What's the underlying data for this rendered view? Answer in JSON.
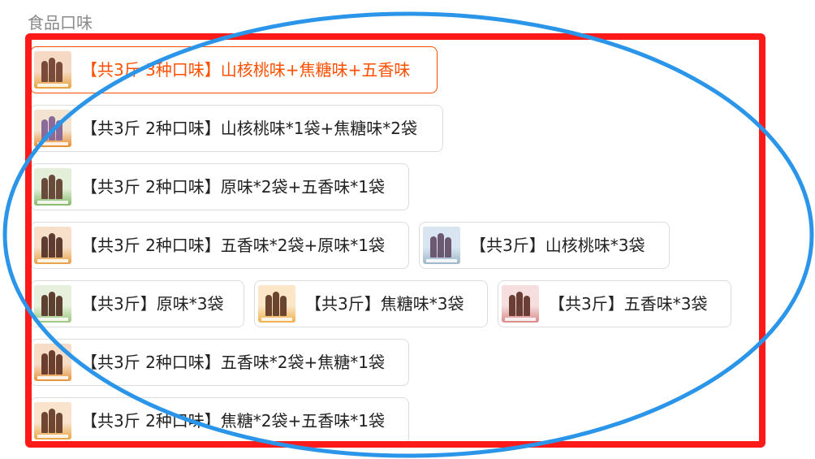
{
  "section_title": "食品口味",
  "options": [
    {
      "label": "【共3斤 3种口味】山核桃味+焦糖味+五香味",
      "selected": true,
      "thumb": {
        "bg": "#f6d9c4",
        "box": "#e6a33a",
        "beans": "#7a4a3a"
      }
    },
    {
      "label": "【共3斤 2种口味】山核桃味*1袋+焦糖味*2袋",
      "selected": false,
      "thumb": {
        "bg": "#f3e4d2",
        "box": "#e98c2d",
        "beans": "#8a6a9a"
      }
    },
    {
      "label": "【共3斤 2种口味】原味*2袋+五香味*1袋",
      "selected": false,
      "thumb": {
        "bg": "#e3efd9",
        "box": "#86b86a",
        "beans": "#6a4a3a"
      }
    },
    {
      "label": "【共3斤 2种口味】五香味*2袋+原味*1袋",
      "selected": false,
      "thumb": {
        "bg": "#f7dfc9",
        "box": "#e7a145",
        "beans": "#5f3c30"
      }
    },
    {
      "label": "【共3斤】山核桃味*3袋",
      "selected": false,
      "thumb": {
        "bg": "#d9e6f2",
        "box": "#9fb6c8",
        "beans": "#6c5870"
      }
    },
    {
      "label": "【共3斤】原味*3袋",
      "selected": false,
      "thumb": {
        "bg": "#e6f0dc",
        "box": "#9cc77d",
        "beans": "#5e4032"
      }
    },
    {
      "label": "【共3斤】焦糖味*3袋",
      "selected": false,
      "thumb": {
        "bg": "#fbe6c8",
        "box": "#f0b04c",
        "beans": "#6b4430"
      }
    },
    {
      "label": "【共3斤】五香味*3袋",
      "selected": false,
      "thumb": {
        "bg": "#f6dede",
        "box": "#d98a8a",
        "beans": "#6a3e34"
      }
    },
    {
      "label": "【共3斤 2种口味】五香味*2袋+焦糖*1袋",
      "selected": false,
      "thumb": {
        "bg": "#f7dcc6",
        "box": "#e5953c",
        "beans": "#6a3f30"
      }
    },
    {
      "label": "【共3斤 2种口味】焦糖*2袋+五香味*1袋",
      "selected": false,
      "thumb": {
        "bg": "#f9e3cd",
        "box": "#eaa545",
        "beans": "#6e4632"
      }
    }
  ],
  "colors": {
    "selected_accent": "#ff5000",
    "annotation_rectangle": "#ff1a1a",
    "annotation_ellipse": "#2b95e9"
  }
}
